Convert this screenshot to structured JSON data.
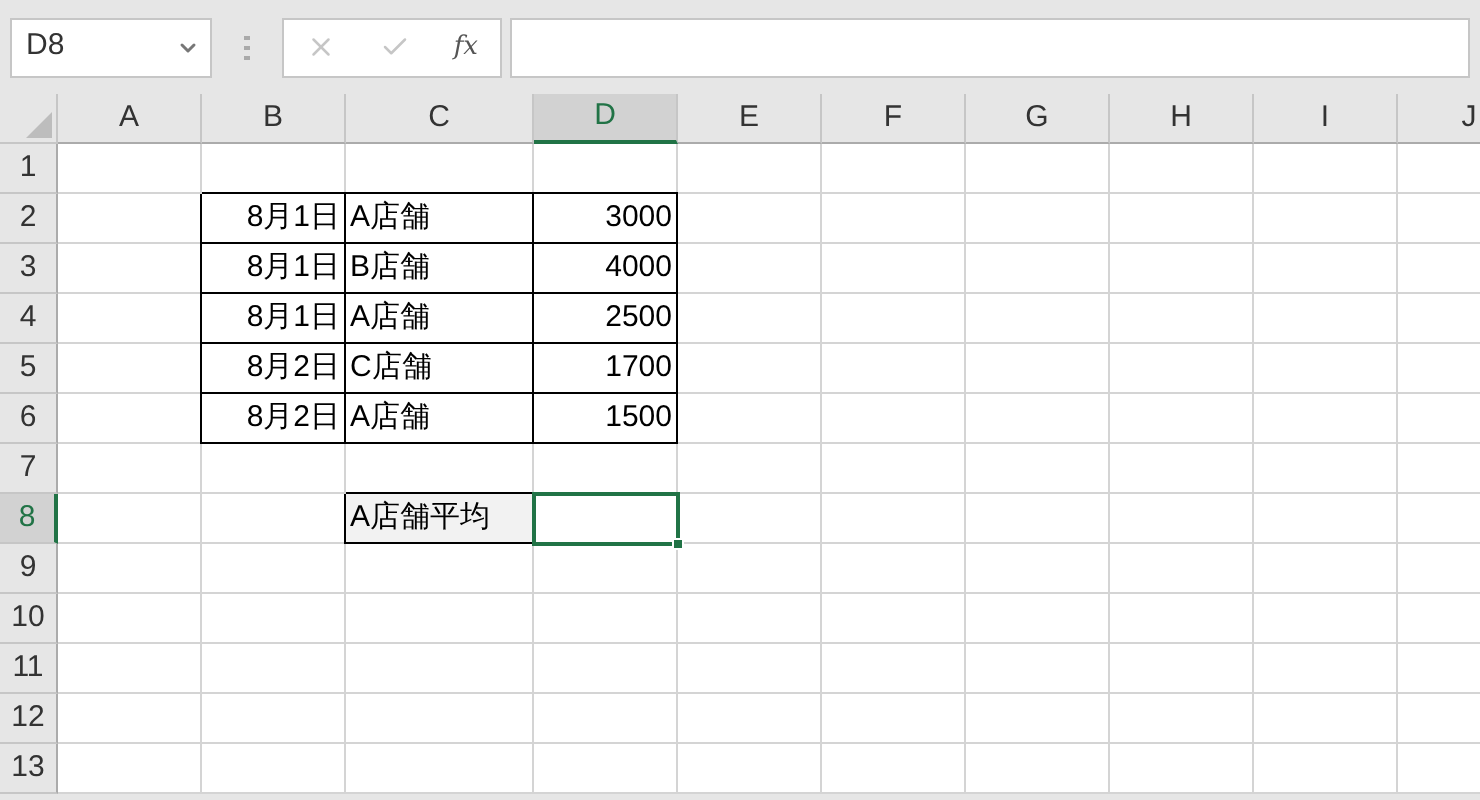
{
  "name_box": {
    "value": "D8"
  },
  "formula_bar": {
    "function_label": "fx"
  },
  "columns": [
    {
      "label": "A",
      "selected": false
    },
    {
      "label": "B",
      "selected": false
    },
    {
      "label": "C",
      "selected": false
    },
    {
      "label": "D",
      "selected": true
    },
    {
      "label": "E",
      "selected": false
    },
    {
      "label": "F",
      "selected": false
    },
    {
      "label": "G",
      "selected": false
    },
    {
      "label": "H",
      "selected": false
    },
    {
      "label": "I",
      "selected": false
    },
    {
      "label": "J",
      "selected": false
    }
  ],
  "rows": [
    {
      "label": "1",
      "selected": false,
      "cells": []
    },
    {
      "label": "2",
      "selected": false,
      "cells": [
        {
          "kind": "date",
          "text": "8月1日",
          "bordered": true
        },
        {
          "kind": "store",
          "text": "A店舗",
          "bordered": true
        },
        {
          "kind": "amount",
          "text": "3000",
          "bordered": true
        }
      ]
    },
    {
      "label": "3",
      "selected": false,
      "cells": [
        {
          "kind": "date",
          "text": "8月1日",
          "bordered": true
        },
        {
          "kind": "store",
          "text": "B店舗",
          "bordered": true
        },
        {
          "kind": "amount",
          "text": "4000",
          "bordered": true
        }
      ]
    },
    {
      "label": "4",
      "selected": false,
      "cells": [
        {
          "kind": "date",
          "text": "8月1日",
          "bordered": true
        },
        {
          "kind": "store",
          "text": "A店舗",
          "bordered": true
        },
        {
          "kind": "amount",
          "text": "2500",
          "bordered": true
        }
      ]
    },
    {
      "label": "5",
      "selected": false,
      "cells": [
        {
          "kind": "date",
          "text": "8月2日",
          "bordered": true
        },
        {
          "kind": "store",
          "text": "C店舗",
          "bordered": true
        },
        {
          "kind": "amount",
          "text": "1700",
          "bordered": true
        }
      ]
    },
    {
      "label": "6",
      "selected": false,
      "cells": [
        {
          "kind": "date",
          "text": "8月2日",
          "bordered": true
        },
        {
          "kind": "store",
          "text": "A店舗",
          "bordered": true
        },
        {
          "kind": "amount",
          "text": "1500",
          "bordered": true
        }
      ]
    },
    {
      "label": "7",
      "selected": false,
      "cells": []
    },
    {
      "label": "8",
      "selected": true,
      "cells": [
        {
          "kind": "store",
          "text": "A店舗平均",
          "bordered": true,
          "shaded": true
        },
        {
          "kind": "amount",
          "bordered": true,
          "selected": true
        }
      ]
    },
    {
      "label": "9",
      "selected": false,
      "cells": []
    },
    {
      "label": "10",
      "selected": false,
      "cells": []
    },
    {
      "label": "11",
      "selected": false,
      "cells": []
    },
    {
      "label": "12",
      "selected": false,
      "cells": []
    },
    {
      "label": "13",
      "selected": false,
      "cells": []
    }
  ]
}
